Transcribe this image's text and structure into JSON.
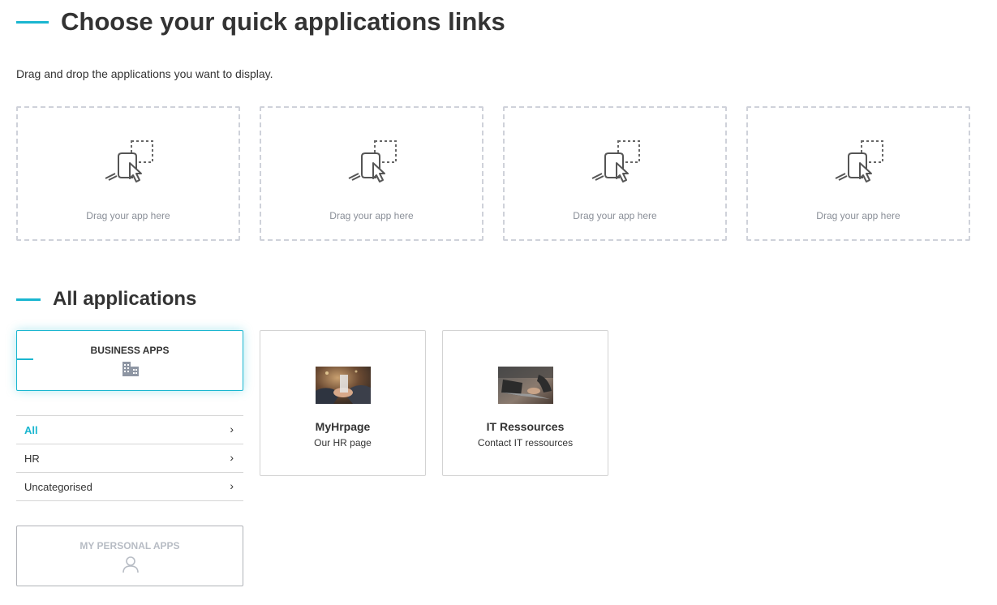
{
  "quick_links": {
    "title": "Choose your quick applications links",
    "instruction": "Drag and drop the applications you want to display.",
    "dropzones": [
      {
        "label": "Drag your app here",
        "icon": "drag-drop-icon"
      },
      {
        "label": "Drag your app here",
        "icon": "drag-drop-icon"
      },
      {
        "label": "Drag your app here",
        "icon": "drag-drop-icon"
      },
      {
        "label": "Drag your app here",
        "icon": "drag-drop-icon"
      }
    ]
  },
  "all_apps": {
    "title": "All applications",
    "business_apps": {
      "label": "BUSINESS APPS",
      "icon": "building-icon"
    },
    "categories": [
      {
        "label": "All",
        "active": true
      },
      {
        "label": "HR",
        "active": false
      },
      {
        "label": "Uncategorised",
        "active": false
      }
    ],
    "personal_apps": {
      "label": "MY PERSONAL APPS",
      "icon": "user-icon"
    },
    "apps": [
      {
        "name": "MyHrpage",
        "description": "Our HR page",
        "thumbnail": "handshake-photo"
      },
      {
        "name": "IT Ressources",
        "description": "Contact IT ressources",
        "thumbnail": "laptop-photo"
      }
    ]
  },
  "colors": {
    "accent": "#1ab6d0",
    "text": "#333333",
    "muted": "#8a8f98",
    "dashed_border": "#cfd2da"
  }
}
